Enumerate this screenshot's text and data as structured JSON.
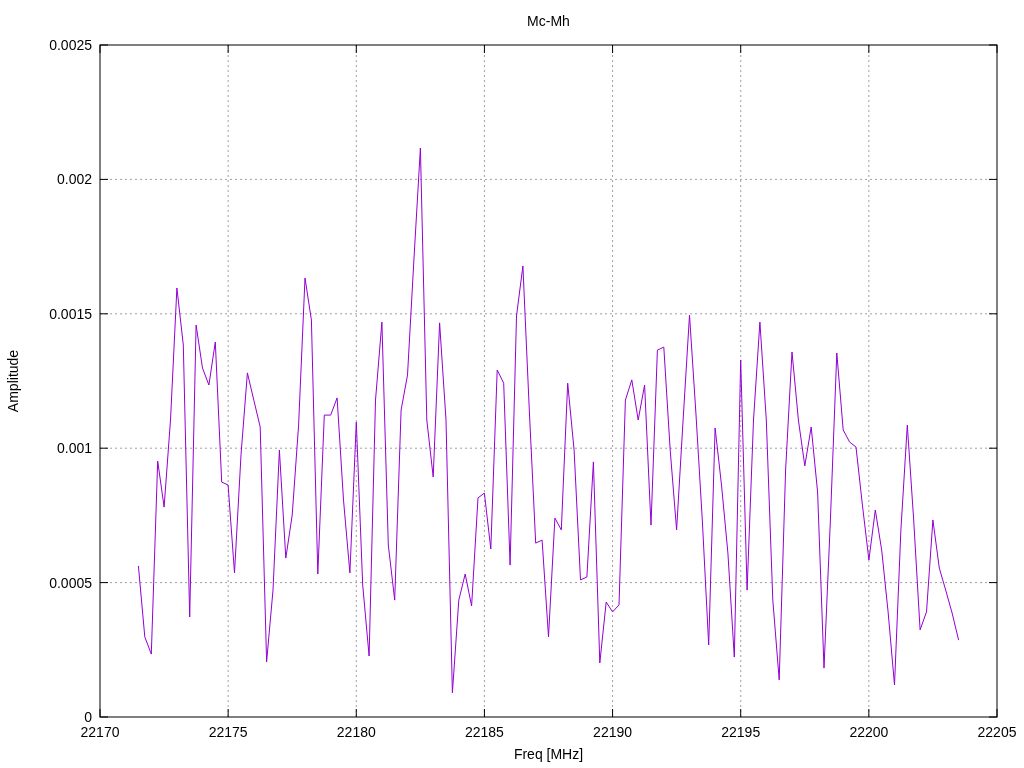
{
  "chart": {
    "chart_data": {
      "type": "line",
      "grid": true,
      "title": "Mc-Mh",
      "xlabel": "Freq [MHz]",
      "ylabel": "Amplitude",
      "xlim": [
        22170,
        22205
      ],
      "ylim": [
        0,
        0.0025
      ],
      "xticks": [
        22170,
        22175,
        22180,
        22185,
        22190,
        22195,
        22200,
        22205
      ],
      "yticks": [
        {
          "value": 0,
          "label": "0"
        },
        {
          "value": 0.0005,
          "label": "0.0005"
        },
        {
          "value": 0.001,
          "label": "0.001"
        },
        {
          "value": 0.0015,
          "label": "0.0015"
        },
        {
          "value": 0.002,
          "label": "0.002"
        },
        {
          "value": 0.0025,
          "label": "0.0025"
        }
      ],
      "x": [
        22171.5,
        22171.75,
        22172,
        22172.25,
        22172.5,
        22172.75,
        22173,
        22173.25,
        22173.5,
        22173.75,
        22174,
        22174.25,
        22174.5,
        22174.75,
        22175,
        22175.25,
        22175.5,
        22175.75,
        22176,
        22176.25,
        22176.5,
        22176.75,
        22177,
        22177.25,
        22177.5,
        22177.75,
        22178,
        22178.25,
        22178.5,
        22178.75,
        22179,
        22179.25,
        22179.5,
        22179.75,
        22180,
        22180.25,
        22180.5,
        22180.75,
        22181,
        22181.25,
        22181.5,
        22181.75,
        22182,
        22182.25,
        22182.5,
        22182.75,
        22183,
        22183.25,
        22183.5,
        22183.75,
        22184,
        22184.25,
        22184.5,
        22184.75,
        22185,
        22185.25,
        22185.5,
        22185.75,
        22186,
        22186.25,
        22186.5,
        22186.75,
        22187,
        22187.25,
        22187.5,
        22187.75,
        22188,
        22188.25,
        22188.5,
        22188.75,
        22189,
        22189.25,
        22189.5,
        22189.75,
        22190,
        22190.25,
        22190.5,
        22190.75,
        22191,
        22191.25,
        22191.5,
        22191.75,
        22192,
        22192.25,
        22192.5,
        22192.75,
        22193,
        22193.25,
        22193.5,
        22193.75,
        22194,
        22194.25,
        22194.5,
        22194.75,
        22195,
        22195.25,
        22195.5,
        22195.75,
        22196,
        22196.25,
        22196.5,
        22196.75,
        22197,
        22197.25,
        22197.5,
        22197.75,
        22198,
        22198.25,
        22198.5,
        22198.75,
        22199,
        22199.25,
        22199.5,
        22199.75,
        22200,
        22200.25,
        22200.5,
        22200.75,
        22201,
        22201.25,
        22201.5,
        22201.75,
        22202,
        22202.25,
        22202.5,
        22202.75,
        22203,
        22203.25,
        22203.5
      ],
      "series": [
        {
          "color": "#9400d3",
          "values": [
            0.000562,
            0.000298,
            0.000234,
            0.000952,
            0.000781,
            0.001105,
            0.001596,
            0.001384,
            0.000372,
            0.001458,
            0.001298,
            0.001235,
            0.001395,
            0.000874,
            0.000863,
            0.000536,
            0.000975,
            0.00128,
            0.001179,
            0.001079,
            0.000205,
            0.000472,
            0.000993,
            0.000591,
            0.000751,
            0.001086,
            0.001633,
            0.001477,
            0.000532,
            0.001123,
            0.001123,
            0.001187,
            0.000807,
            0.000536,
            0.001097,
            0.000491,
            0.000227,
            0.001179,
            0.001469,
            0.00064,
            0.000435,
            0.001142,
            0.001272,
            0.0017,
            0.002117,
            0.001105,
            0.000893,
            0.001466,
            0.001105,
            9e-05,
            0.000435,
            0.000532,
            0.000413,
            0.000815,
            0.000833,
            0.000625,
            0.001291,
            0.001242,
            0.000565,
            0.001492,
            0.001678,
            0.001142,
            0.000647,
            0.000658,
            0.000298,
            0.00074,
            0.000696,
            0.001242,
            0.000993,
            0.00051,
            0.000521,
            0.000949,
            0.000201,
            0.000428,
            0.000391,
            0.000417,
            0.001179,
            0.001254,
            0.001105,
            0.001235,
            0.000714,
            0.001365,
            0.001376,
            0.000993,
            0.000696,
            0.001105,
            0.001495,
            0.001131,
            0.000733,
            0.000268,
            0.001075,
            0.000863,
            0.00061,
            0.000223,
            0.001328,
            0.000472,
            0.001105,
            0.001469,
            0.001105,
            0.000435,
            0.000138,
            0.000919,
            0.001358,
            0.001105,
            0.000934,
            0.001079,
            0.000837,
            0.000182,
            0.000733,
            0.001354,
            0.001068,
            0.001023,
            0.001004,
            0.000789,
            0.000584,
            0.00077,
            0.000621,
            0.000391,
            0.000119,
            0.000696,
            0.001086,
            0.000733,
            0.000324,
            0.000391,
            0.000733,
            0.000554,
            0.000472,
            0.000387,
            0.000286
          ]
        }
      ]
    }
  }
}
